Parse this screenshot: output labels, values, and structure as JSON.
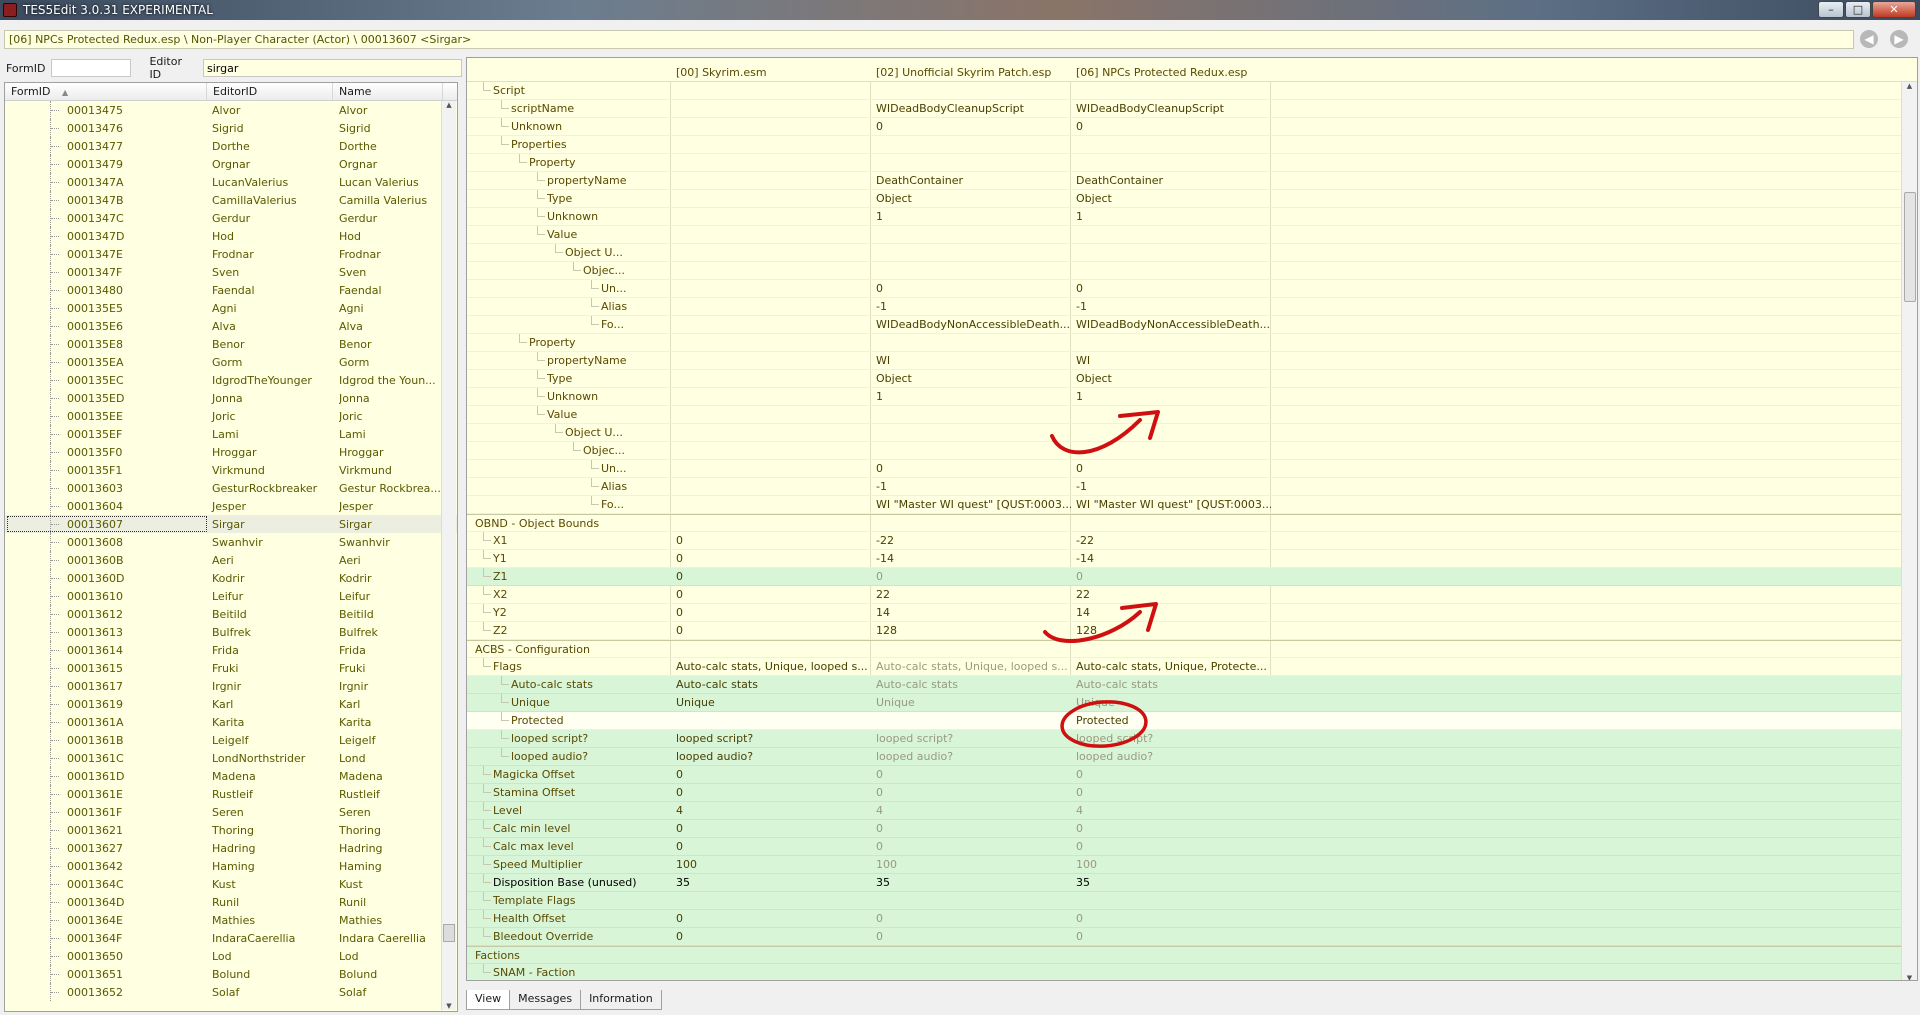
{
  "window": {
    "title": "TES5Edit 3.0.31 EXPERIMENTAL",
    "minimize": "–",
    "maximize": "□",
    "close": "✕"
  },
  "path": "[06] NPCs Protected Redux.esp \\ Non-Player Character (Actor) \\ 00013607 <Sirgar>",
  "filter": {
    "formid_label": "FormID",
    "formid_value": "",
    "editorid_label": "Editor ID",
    "editorid_value": "sirgar"
  },
  "nav": {
    "back": "◀",
    "forward": "▶"
  },
  "left": {
    "columns": [
      "FormID",
      "EditorID",
      "Name"
    ],
    "sort_indicator": "▲",
    "rows": [
      [
        "00013475",
        "Alvor",
        "Alvor"
      ],
      [
        "00013476",
        "Sigrid",
        "Sigrid"
      ],
      [
        "00013477",
        "Dorthe",
        "Dorthe"
      ],
      [
        "00013479",
        "Orgnar",
        "Orgnar"
      ],
      [
        "0001347A",
        "LucanValerius",
        "Lucan Valerius"
      ],
      [
        "0001347B",
        "CamillaValerius",
        "Camilla Valerius"
      ],
      [
        "0001347C",
        "Gerdur",
        "Gerdur"
      ],
      [
        "0001347D",
        "Hod",
        "Hod"
      ],
      [
        "0001347E",
        "Frodnar",
        "Frodnar"
      ],
      [
        "0001347F",
        "Sven",
        "Sven"
      ],
      [
        "00013480",
        "Faendal",
        "Faendal"
      ],
      [
        "000135E5",
        "Agni",
        "Agni"
      ],
      [
        "000135E6",
        "Alva",
        "Alva"
      ],
      [
        "000135E8",
        "Benor",
        "Benor"
      ],
      [
        "000135EA",
        "Gorm",
        "Gorm"
      ],
      [
        "000135EC",
        "IdgrodTheYounger",
        "Idgrod the Youn..."
      ],
      [
        "000135ED",
        "Jonna",
        "Jonna"
      ],
      [
        "000135EE",
        "Joric",
        "Joric"
      ],
      [
        "000135EF",
        "Lami",
        "Lami"
      ],
      [
        "000135F0",
        "Hroggar",
        "Hroggar"
      ],
      [
        "000135F1",
        "Virkmund",
        "Virkmund"
      ],
      [
        "00013603",
        "GesturRockbreaker",
        "Gestur Rockbrea..."
      ],
      [
        "00013604",
        "Jesper",
        "Jesper"
      ],
      [
        "00013607",
        "Sirgar",
        "Sirgar"
      ],
      [
        "00013608",
        "Swanhvir",
        "Swanhvir"
      ],
      [
        "0001360B",
        "Aeri",
        "Aeri"
      ],
      [
        "0001360D",
        "Kodrir",
        "Kodrir"
      ],
      [
        "00013610",
        "Leifur",
        "Leifur"
      ],
      [
        "00013612",
        "Beitild",
        "Beitild"
      ],
      [
        "00013613",
        "Bulfrek",
        "Bulfrek"
      ],
      [
        "00013614",
        "Frida",
        "Frida"
      ],
      [
        "00013615",
        "Fruki",
        "Fruki"
      ],
      [
        "00013617",
        "Irgnir",
        "Irgnir"
      ],
      [
        "00013619",
        "Karl",
        "Karl"
      ],
      [
        "0001361A",
        "Karita",
        "Karita"
      ],
      [
        "0001361B",
        "Leigelf",
        "Leigelf"
      ],
      [
        "0001361C",
        "LondNorthstrider",
        "Lond"
      ],
      [
        "0001361D",
        "Madena",
        "Madena"
      ],
      [
        "0001361E",
        "Rustleif",
        "Rustleif"
      ],
      [
        "0001361F",
        "Seren",
        "Seren"
      ],
      [
        "00013621",
        "Thoring",
        "Thoring"
      ],
      [
        "00013627",
        "Hadring",
        "Hadring"
      ],
      [
        "00013642",
        "Haming",
        "Haming"
      ],
      [
        "0001364C",
        "Kust",
        "Kust"
      ],
      [
        "0001364D",
        "Runil",
        "Runil"
      ],
      [
        "0001364E",
        "Mathies",
        "Mathies"
      ],
      [
        "0001364F",
        "IndaraCaerellia",
        "Indara Caerellia"
      ],
      [
        "00013650",
        "Lod",
        "Lod"
      ],
      [
        "00013651",
        "Bolund",
        "Bolund"
      ],
      [
        "00013652",
        "Solaf",
        "Solaf"
      ]
    ],
    "selected_index": 23
  },
  "right": {
    "columns": [
      "[00] Skyrim.esm",
      "[02] Unofficial Skyrim Patch.esp",
      "[06] NPCs Protected Redux.esp"
    ],
    "rows": [
      {
        "d": 1,
        "label": "Script",
        "v": [
          "",
          "",
          ""
        ]
      },
      {
        "d": 2,
        "label": "scriptName",
        "v": [
          "",
          "WIDeadBodyCleanupScript",
          "WIDeadBodyCleanupScript"
        ]
      },
      {
        "d": 2,
        "label": "Unknown",
        "v": [
          "",
          "0",
          "0"
        ]
      },
      {
        "d": 2,
        "label": "Properties",
        "v": [
          "",
          "",
          ""
        ]
      },
      {
        "d": 3,
        "label": "Property",
        "v": [
          "",
          "",
          ""
        ]
      },
      {
        "d": 4,
        "label": "propertyName",
        "v": [
          "",
          "DeathContainer",
          "DeathContainer"
        ]
      },
      {
        "d": 4,
        "label": "Type",
        "v": [
          "",
          "Object",
          "Object"
        ]
      },
      {
        "d": 4,
        "label": "Unknown",
        "v": [
          "",
          "1",
          "1"
        ]
      },
      {
        "d": 4,
        "label": "Value",
        "v": [
          "",
          "",
          ""
        ]
      },
      {
        "d": 5,
        "label": "Object U...",
        "v": [
          "",
          "",
          ""
        ]
      },
      {
        "d": 6,
        "label": "Objec...",
        "v": [
          "",
          "",
          ""
        ]
      },
      {
        "d": 7,
        "label": "Un...",
        "v": [
          "",
          "0",
          "0"
        ]
      },
      {
        "d": 7,
        "label": "Alias",
        "v": [
          "",
          "-1",
          "-1"
        ]
      },
      {
        "d": 7,
        "label": "Fo...",
        "v": [
          "",
          "WIDeadBodyNonAccessibleDeath...",
          "WIDeadBodyNonAccessibleDeath..."
        ]
      },
      {
        "d": 3,
        "label": "Property",
        "v": [
          "",
          "",
          ""
        ]
      },
      {
        "d": 4,
        "label": "propertyName",
        "v": [
          "",
          "WI",
          "WI"
        ]
      },
      {
        "d": 4,
        "label": "Type",
        "v": [
          "",
          "Object",
          "Object"
        ]
      },
      {
        "d": 4,
        "label": "Unknown",
        "v": [
          "",
          "1",
          "1"
        ]
      },
      {
        "d": 4,
        "label": "Value",
        "v": [
          "",
          "",
          ""
        ]
      },
      {
        "d": 5,
        "label": "Object U...",
        "v": [
          "",
          "",
          ""
        ]
      },
      {
        "d": 6,
        "label": "Objec...",
        "v": [
          "",
          "",
          ""
        ]
      },
      {
        "d": 7,
        "label": "Un...",
        "v": [
          "",
          "0",
          "0"
        ]
      },
      {
        "d": 7,
        "label": "Alias",
        "v": [
          "",
          "-1",
          "-1"
        ]
      },
      {
        "d": 7,
        "label": "Fo...",
        "v": [
          "",
          "WI \"Master WI quest\" [QUST:0003...",
          "WI \"Master WI quest\" [QUST:0003..."
        ]
      },
      {
        "d": 0,
        "label": "OBND - Object Bounds",
        "v": [
          "",
          "",
          ""
        ],
        "sec": true
      },
      {
        "d": 1,
        "label": "X1",
        "v": [
          "0",
          "-22",
          "-22"
        ]
      },
      {
        "d": 1,
        "label": "Y1",
        "v": [
          "0",
          "-14",
          "-14"
        ]
      },
      {
        "d": 1,
        "label": "Z1",
        "v": [
          "0",
          "0",
          "0"
        ],
        "bg": "green",
        "gray": true
      },
      {
        "d": 1,
        "label": "X2",
        "v": [
          "0",
          "22",
          "22"
        ]
      },
      {
        "d": 1,
        "label": "Y2",
        "v": [
          "0",
          "14",
          "14"
        ]
      },
      {
        "d": 1,
        "label": "Z2",
        "v": [
          "0",
          "128",
          "128"
        ]
      },
      {
        "d": 0,
        "label": "ACBS - Configuration",
        "v": [
          "",
          "",
          ""
        ],
        "sec": true
      },
      {
        "d": 1,
        "label": "Flags",
        "v": [
          "Auto-calc stats, Unique, looped s...",
          "Auto-calc stats, Unique, looped s...",
          "Auto-calc stats, Unique, Protecte..."
        ],
        "gray1": true
      },
      {
        "d": 2,
        "label": "Auto-calc stats",
        "v": [
          "Auto-calc stats",
          "Auto-calc stats",
          "Auto-calc stats"
        ],
        "bg": "green",
        "gray": true
      },
      {
        "d": 2,
        "label": "Unique",
        "v": [
          "Unique",
          "Unique",
          "Unique"
        ],
        "bg": "green",
        "gray": true
      },
      {
        "d": 2,
        "label": "Protected",
        "v": [
          "",
          "",
          "Protected"
        ],
        "bg": "white"
      },
      {
        "d": 2,
        "label": "looped script?",
        "v": [
          "looped script?",
          "looped script?",
          "looped script?"
        ],
        "bg": "green",
        "gray": true
      },
      {
        "d": 2,
        "label": "looped audio?",
        "v": [
          "looped audio?",
          "looped audio?",
          "looped audio?"
        ],
        "bg": "green",
        "gray": true
      },
      {
        "d": 1,
        "label": "Magicka Offset",
        "v": [
          "0",
          "0",
          "0"
        ],
        "bg": "green",
        "gray": true
      },
      {
        "d": 1,
        "label": "Stamina Offset",
        "v": [
          "0",
          "0",
          "0"
        ],
        "bg": "green",
        "gray": true
      },
      {
        "d": 1,
        "label": "Level",
        "v": [
          "4",
          "4",
          "4"
        ],
        "bg": "green",
        "gray": true
      },
      {
        "d": 1,
        "label": "Calc min level",
        "v": [
          "0",
          "0",
          "0"
        ],
        "bg": "green",
        "gray": true
      },
      {
        "d": 1,
        "label": "Calc max level",
        "v": [
          "0",
          "0",
          "0"
        ],
        "bg": "green",
        "gray": true
      },
      {
        "d": 1,
        "label": "Speed Multiplier",
        "v": [
          "100",
          "100",
          "100"
        ],
        "bg": "green",
        "gray": true
      },
      {
        "d": 1,
        "label": "Disposition Base (unused)",
        "v": [
          "35",
          "35",
          "35"
        ],
        "bg": "green",
        "bold": true
      },
      {
        "d": 1,
        "label": "Template Flags",
        "v": [
          "",
          "",
          ""
        ],
        "bg": "green"
      },
      {
        "d": 1,
        "label": "Health Offset",
        "v": [
          "0",
          "0",
          "0"
        ],
        "bg": "green",
        "gray": true
      },
      {
        "d": 1,
        "label": "Bleedout Override",
        "v": [
          "0",
          "0",
          "0"
        ],
        "bg": "green",
        "gray": true
      },
      {
        "d": 0,
        "label": "Factions",
        "v": [
          "",
          "",
          ""
        ],
        "bg": "green",
        "sec": true
      },
      {
        "d": 1,
        "label": "SNAM - Faction",
        "v": [
          "",
          "",
          ""
        ],
        "bg": "green"
      }
    ]
  },
  "tabs": [
    "View",
    "Messages",
    "Information"
  ],
  "scroll": {
    "up": "▲",
    "down": "▼"
  },
  "colors": {
    "annotation": "#d01010",
    "green_row": "#d8f5d8",
    "yellow_bg": "#ffffe1"
  }
}
